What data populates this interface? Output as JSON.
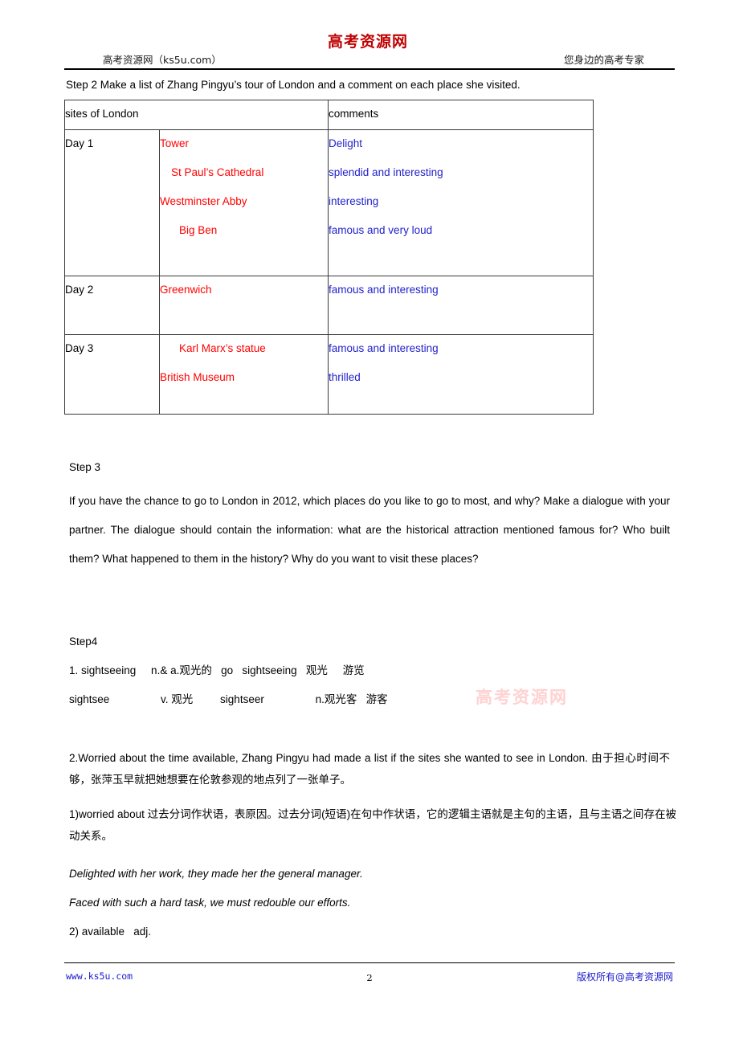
{
  "header": {
    "logo_text": "高考资源网",
    "left_text": "高考资源网（ks5u.com）",
    "right_text": "您身边的高考专家"
  },
  "step2": {
    "instruction": "Step 2 Make a list of Zhang Pingyu’s tour of London and a comment on each place she visited."
  },
  "table": {
    "headers": {
      "sites": "sites of London",
      "comments": "comments"
    },
    "rows": [
      {
        "day": "Day 1",
        "sites": [
          {
            "text": "Tower",
            "indent": 0
          },
          {
            "text": "St Paul’s Cathedral",
            "indent": 1
          },
          {
            "text": "Westminster Abby",
            "indent": 0
          },
          {
            "text": "Big Ben",
            "indent": 2
          }
        ],
        "comments": [
          "Delight",
          "splendid and interesting",
          "interesting",
          "famous and very loud"
        ]
      },
      {
        "day": "Day 2",
        "sites": [
          {
            "text": "Greenwich",
            "indent": 0
          }
        ],
        "comments": [
          "famous and interesting"
        ]
      },
      {
        "day": "Day 3",
        "sites": [
          {
            "text": "Karl Marx’s statue",
            "indent": 2
          },
          {
            "text": "British Museum",
            "indent": 0
          }
        ],
        "comments": [
          "famous and interesting",
          "thrilled"
        ]
      }
    ]
  },
  "step3": {
    "label": "Step 3",
    "body": "If you have the chance to go to London in 2012,    which places do you like to go to most, and why? Make a dialogue with your partner. The dialogue should contain the information: what are the historical attraction mentioned famous for? Who built them? What happened to them in the history? Why do you want to visit these places?"
  },
  "step4": {
    "label": "Step4",
    "vocab_line_1": "1. sightseeing     n.& a.观光的   go   sightseeing   观光     游览",
    "vocab_line_2": "sightsee                 v. 观光         sightseer                 n.观光客   游客",
    "watermark": "高考资源网"
  },
  "notes": {
    "item2": "2.Worried about the time available, Zhang Pingyu had made a list if the sites she wanted to see in London.  由于担心时间不够，张萍玉早就把她想要在伦敦参观的地点列了一张单子。",
    "item2_sub1": "1)worried about  过去分词作状语，表原因。过去分词(短语)在句中作状语，它的逻辑主语就是主句的主语，且与主语之间存在被动关系。",
    "example_1": "Delighted with her work, they made her the general manager.",
    "example_2": "Faced with such a hard task, we must redouble our efforts.",
    "item2_sub2": "2) available   adj."
  },
  "footer": {
    "url": "www.ks5u.com",
    "page_number": "2",
    "copyright": "版权所有@高考资源网"
  }
}
